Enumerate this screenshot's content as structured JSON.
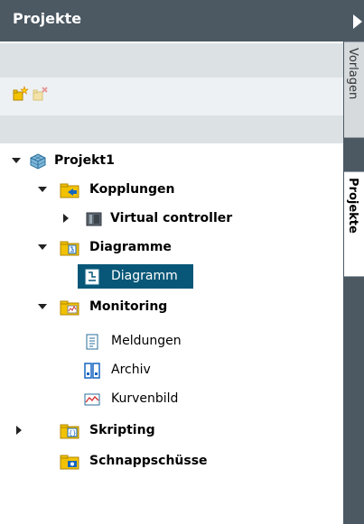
{
  "panel": {
    "title": "Projekte"
  },
  "sidebar": {
    "tabs": [
      {
        "label": "Vorlagen"
      },
      {
        "label": "Projekte"
      }
    ]
  },
  "toolbar": {
    "icons": [
      "new-item-icon",
      "delete-item-icon"
    ]
  },
  "tree": {
    "items": [
      {
        "label": "Projekt1",
        "icon": "project-cube-icon",
        "expanded": true
      },
      {
        "label": "Kopplungen",
        "icon": "connections-folder-icon",
        "expanded": true
      },
      {
        "label": "Virtual controller",
        "icon": "controller-icon",
        "expanded": false
      },
      {
        "label": "Diagramme",
        "icon": "diagram-folder-icon",
        "expanded": true
      },
      {
        "label": "Diagramm",
        "icon": "diagram-icon",
        "selected": true
      },
      {
        "label": "Monitoring",
        "icon": "monitoring-folder-icon",
        "expanded": true
      },
      {
        "label": "Meldungen",
        "icon": "messages-icon"
      },
      {
        "label": "Archiv",
        "icon": "archive-icon"
      },
      {
        "label": "Kurvenbild",
        "icon": "trend-chart-icon"
      },
      {
        "label": "Skripting",
        "icon": "scripting-folder-icon",
        "expanded": false
      },
      {
        "label": "Schnappschüsse",
        "icon": "snapshots-folder-icon"
      }
    ]
  },
  "colors": {
    "header": "#4c5963",
    "selection": "#085778",
    "band": "#dce1e4",
    "toolbar": "#eef1f3"
  }
}
